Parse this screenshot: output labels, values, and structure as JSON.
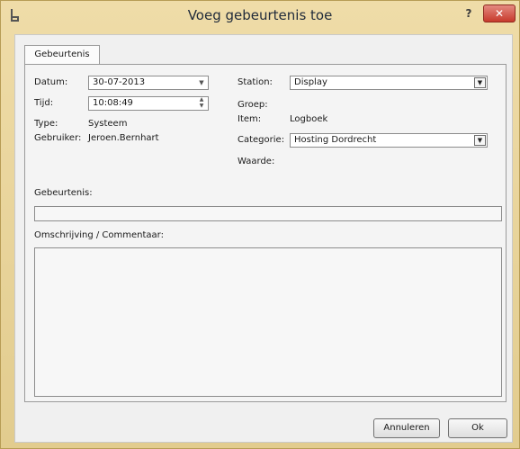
{
  "window": {
    "title": "Voeg gebeurtenis toe",
    "help_label": "?",
    "close_label": "✕"
  },
  "tabs": [
    {
      "label": "Gebeurtenis"
    }
  ],
  "form": {
    "datum_label": "Datum:",
    "datum_value": "30-07-2013",
    "tijd_label": "Tijd:",
    "tijd_value": "10:08:49",
    "type_label": "Type:",
    "type_value": "Systeem",
    "gebruiker_label": "Gebruiker:",
    "gebruiker_value": "Jeroen.Bernhart",
    "station_label": "Station:",
    "station_value": "Display",
    "groep_label": "Groep:",
    "item_label": "Item:",
    "item_value": "Logboek",
    "categorie_label": "Categorie:",
    "categorie_value": "Hosting Dordrecht",
    "waarde_label": "Waarde:",
    "gebeurtenis_label": "Gebeurtenis:",
    "gebeurtenis_value": "",
    "omschrijving_label": "Omschrijving / Commentaar:",
    "omschrijving_value": ""
  },
  "buttons": {
    "cancel_label": "Annuleren",
    "ok_label": "Ok"
  },
  "icons": {
    "app": "app-icon",
    "dropdown": "chevron-down-icon",
    "spin_up": "spin-up-icon",
    "spin_down": "spin-down-icon"
  }
}
